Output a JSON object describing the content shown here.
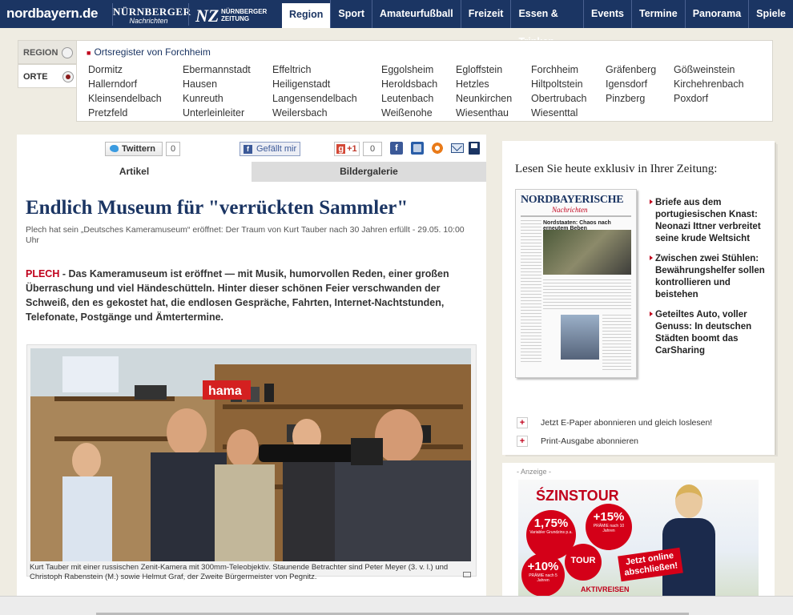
{
  "nav": {
    "logo_main": "nordbayern.de",
    "logo_nn_big": "NÜRNBERGER",
    "logo_nn_small": "Nachrichten",
    "logo_nz_mark": "NZ",
    "logo_nz_text": "NÜRNBERGER ZEITUNG",
    "items": [
      {
        "label": "Region",
        "active": true
      },
      {
        "label": "Sport"
      },
      {
        "label": "Amateurfußball"
      },
      {
        "label": "Freizeit"
      },
      {
        "label": "Essen & Trinken"
      },
      {
        "label": "Events"
      },
      {
        "label": "Termine"
      },
      {
        "label": "Panorama"
      },
      {
        "label": "Spiele"
      }
    ]
  },
  "register": {
    "tab_region": "REGION",
    "tab_orte": "ORTE",
    "title": "Ortsregister von Forchheim",
    "places": [
      "Dormitz",
      "Ebermannstadt",
      "Effeltrich",
      "Eggolsheim",
      "Egloffstein",
      "Forchheim",
      "Gräfenberg",
      "Gößweinstein",
      "Hallerndorf",
      "Hausen",
      "Heiligenstadt",
      "Heroldsbach",
      "Hetzles",
      "Hiltpoltstein",
      "Igensdorf",
      "Kirchehrenbach",
      "Kleinsendelbach",
      "Kunreuth",
      "Langensendelbach",
      "Leutenbach",
      "Neunkirchen",
      "Obertrubach",
      "Pinzberg",
      "Poxdorf",
      "Pretzfeld",
      "Unterleinleiter",
      "Weilersbach",
      "Weißenohe",
      "Wiesenthau",
      "Wiesenttal"
    ]
  },
  "share": {
    "twitter_label": "Twittern",
    "twitter_count": "0",
    "facebook_label": "Gefällt mir",
    "gplus_label": "+1",
    "gplus_count": "0"
  },
  "tabs": {
    "artikel": "Artikel",
    "galerie": "Bildergalerie"
  },
  "article": {
    "headline": "Endlich Museum für \"verrückten Sammler\"",
    "subline": "Plech hat sein „Deutsches Kameramuseum“ eröffnet: Der Traum von Kurt Tauber nach 30 Jahren erfüllt - 29.05. 10:00 Uhr",
    "dateline": "PLECH",
    "lead": " - Das Kameramuseum ist eröffnet — mit Musik, humorvollen Reden, einer großen Überraschung  und viel Händeschütteln. Hinter dieser schönen Feier verschwanden der Schweiß, den es gekostet hat, die endlosen Gespräche, Fahrten, Internet-Nachtstunden, Telefonate, Postgänge und Ämtertermine.",
    "photo_sign": "hama",
    "caption": "Kurt Tauber mit einer russischen Zenit-Kamera mit 300mm-Teleobjektiv. Staunende Betrachter sind Peter Meyer (3. v. l.) und Christoph Rabenstein (M.) sowie Helmut Graf, der Zweite Bürgermeister von Pegnitz."
  },
  "sidebar": {
    "heading": "Lesen Sie heute exklusiv in Ihrer Zeitung:",
    "paper_title": "NORDBAYERISCHE",
    "paper_sub": "Nachrichten",
    "paper_headline": "Nordstaaten: Chaos nach erneutem Beben",
    "teasers": [
      "Briefe aus dem portugiesischen Knast: Neonazi Ittner verbreitet seine krude Weltsicht",
      "Zwischen zwei Stühlen: Bewährungshelfer sollen kontrollieren und beistehen",
      "Geteiltes Auto, voller Genuss: In deutschen Städten boomt das CarSharing"
    ],
    "link_epaper": "Jetzt E-Paper abonnieren und gleich loslesen!",
    "link_print": "Print-Ausgabe abonnieren"
  },
  "ad": {
    "label": "- Anzeige -",
    "brand": "ZINSTOUR",
    "rate1": "1,75%",
    "rate1_desc": "Variabler Grundzins p.a.",
    "rate2": "+15%",
    "rate2_desc": "PRÄMIE nach 10 Jahren",
    "rate3": "+10%",
    "rate3_desc": "PRÄMIE nach 5 Jahren",
    "tour": "TOUR",
    "cta": "Jetzt online abschließen!",
    "footer": "AKTIVREISEN"
  },
  "colors": {
    "nav_bg": "#1b3563",
    "accent_red": "#c0001b",
    "headline_blue": "#1b3563",
    "page_bg": "#efece2"
  }
}
